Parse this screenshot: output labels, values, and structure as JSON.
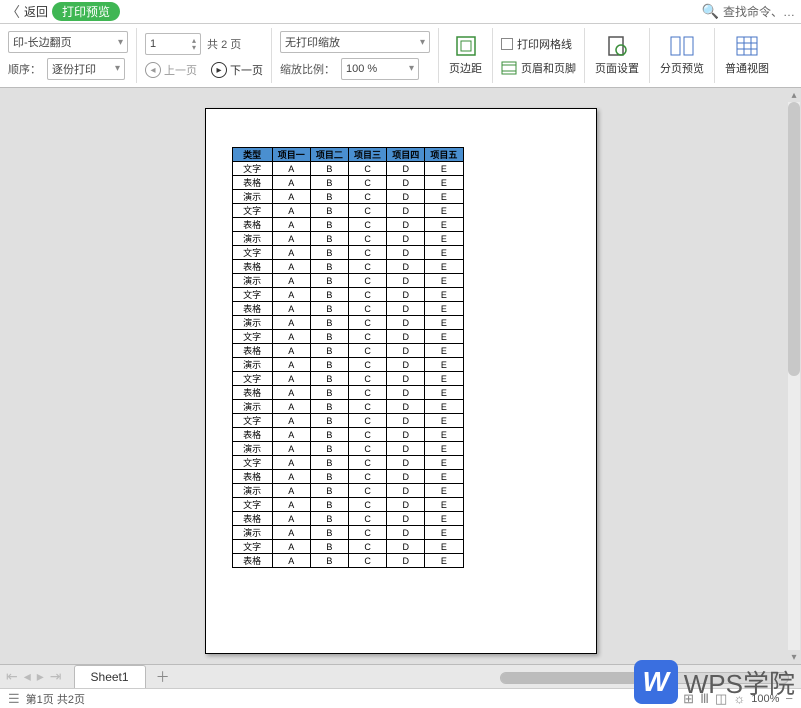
{
  "titlebar": {
    "back": "返回",
    "preview_badge": "打印预览",
    "search_placeholder": "查找命令、…"
  },
  "toolbar": {
    "flip_select": "印-长边翻页",
    "order_label": "顺序：",
    "order_select": "逐份打印",
    "page_input": "1",
    "page_total_prefix": "共",
    "page_total": "2",
    "page_total_suffix": "页",
    "prev": "上一页",
    "next": "下一页",
    "scale_select": "无打印缩放",
    "zoom_label": "缩放比例：",
    "zoom_value": "100 %",
    "margin": "页边距",
    "gridlines": "打印网格线",
    "header_footer": "页眉和页脚",
    "page_setup": "页面设置",
    "page_break": "分页预览",
    "normal_view": "普通视图"
  },
  "table": {
    "headers": [
      "类型",
      "项目一",
      "项目二",
      "项目三",
      "项目四",
      "项目五"
    ],
    "row_values": [
      "A",
      "B",
      "C",
      "D",
      "E"
    ],
    "row_labels": [
      "文字",
      "表格",
      "演示",
      "文字",
      "表格",
      "演示",
      "文字",
      "表格",
      "演示",
      "文字",
      "表格",
      "演示",
      "文字",
      "表格",
      "演示",
      "文字",
      "表格",
      "演示",
      "文字",
      "表格",
      "演示",
      "文字",
      "表格",
      "演示",
      "文字",
      "表格",
      "演示",
      "文字",
      "表格"
    ]
  },
  "tabs": {
    "sheet1": "Sheet1"
  },
  "status": {
    "page_info": "第1页 共2页",
    "zoom": "100%"
  },
  "branding": {
    "logo": "W",
    "text": "WPS学院"
  }
}
